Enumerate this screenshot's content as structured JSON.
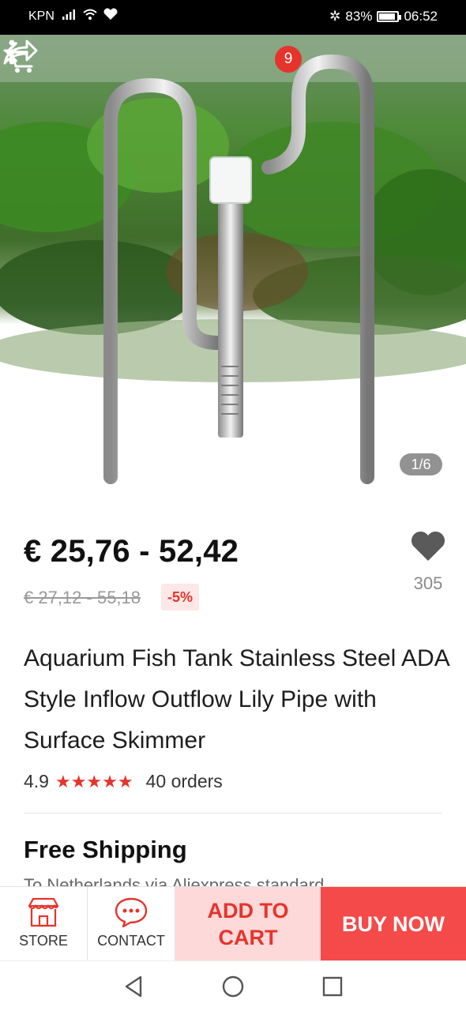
{
  "status_bar": {
    "carrier": "KPN",
    "battery": "83%",
    "time": "06:52"
  },
  "header": {
    "cart_count": "9",
    "icons": [
      "back-arrow-icon",
      "cart-icon",
      "share-icon",
      "more-vertical-icon"
    ]
  },
  "gallery": {
    "counter": "1/6"
  },
  "product": {
    "price": "€ 25,76 - 52,42",
    "original_price": "€ 27,12 - 55,18",
    "discount": "-5%",
    "wishlist_count": "305",
    "title": "Aquarium Fish Tank Stainless Steel ADA Style Inflow Outflow Lily Pipe with Surface Skimmer",
    "rating": "4.9",
    "stars": "★★★★★",
    "orders": "40 orders"
  },
  "shipping": {
    "title": "Free Shipping",
    "subtitle": "To Netherlands via Aliexpress standard"
  },
  "actions": {
    "store": "STORE",
    "contact": "CONTACT",
    "add_to_cart": "ADD TO CART",
    "buy_now": "BUY NOW"
  },
  "colors": {
    "accent": "#e5342c",
    "buy_now_bg": "#f44a4a",
    "add_cart_bg": "#fdd9d9"
  }
}
